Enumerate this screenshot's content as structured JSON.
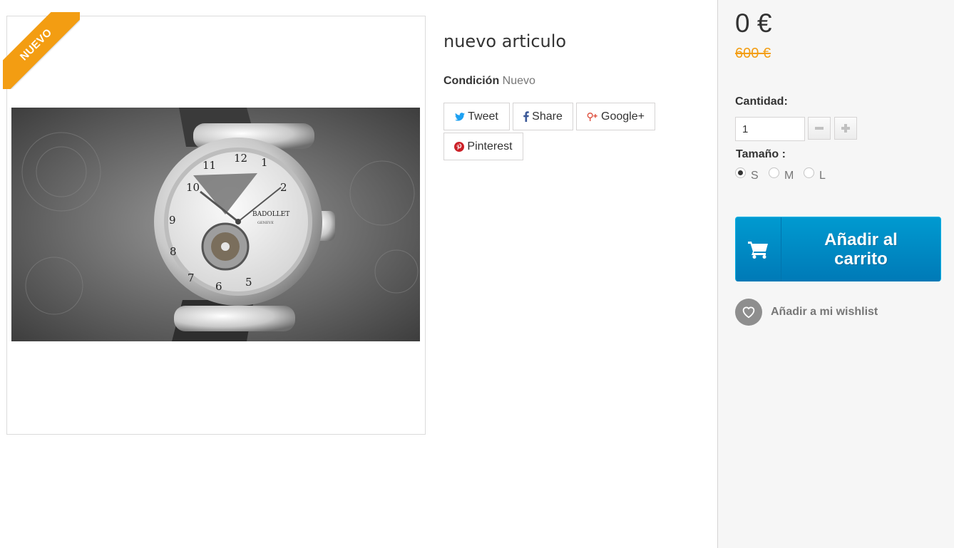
{
  "product": {
    "badge": "Nuevo",
    "title": "nuevo articulo",
    "condition_label": "Condición",
    "condition_value": "Nuevo",
    "image_alt": "watch-photo"
  },
  "social": {
    "tweet": "Tweet",
    "share": "Share",
    "google": "Google+",
    "pinterest": "Pinterest"
  },
  "buy": {
    "price": "0 €",
    "old_price": "600 €",
    "quantity_label": "Cantidad:",
    "quantity_value": "1",
    "size_label": "Tamaño :",
    "sizes": [
      {
        "label": "S",
        "selected": true
      },
      {
        "label": "M",
        "selected": false
      },
      {
        "label": "L",
        "selected": false
      }
    ],
    "cart_label": "Añadir al carrito",
    "wishlist_label": "Añadir a mi wishlist"
  },
  "colors": {
    "accent_blue": "#0088c8",
    "badge_orange": "#f39d12",
    "tweet_blue": "#1da1f2",
    "facebook_blue": "#3b5998",
    "google_red": "#dd4b39",
    "pinterest_red": "#cb2027"
  },
  "icons": [
    "twitter-icon",
    "facebook-icon",
    "google-plus-icon",
    "pinterest-icon",
    "minus-icon",
    "plus-icon",
    "cart-icon",
    "heart-icon"
  ]
}
